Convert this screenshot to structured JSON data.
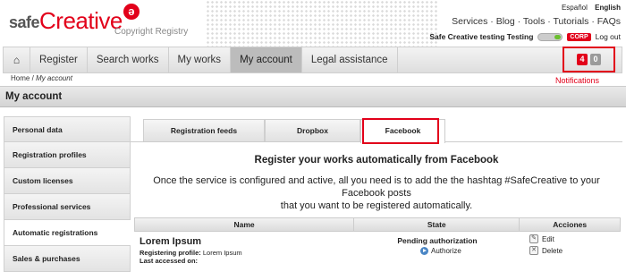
{
  "header": {
    "logo_safe": "safe",
    "logo_creative": "Creative",
    "logo_mark": "ə",
    "subtitle": "Copyright Registry",
    "languages": [
      "Español",
      "English"
    ],
    "toplinks": "Services · Blog · Tools · Tutorials · FAQs",
    "username": "Safe Creative testing Testing",
    "corp_badge": "CORP",
    "logout": "Log out"
  },
  "nav": {
    "home_icon": "⌂",
    "items": [
      "Register",
      "Search works",
      "My works",
      "My account",
      "Legal assistance"
    ],
    "active": "My account"
  },
  "notifications": {
    "count_new": "4",
    "count_other": "0",
    "label": "Notifications"
  },
  "breadcrumb": {
    "home": "Home",
    "separator": "/",
    "current": "My account"
  },
  "page_title": "My account",
  "sidebar": {
    "items": [
      "Personal data",
      "Registration profiles",
      "Custom licenses",
      "Professional services",
      "Automatic registrations",
      "Sales & purchases"
    ],
    "active": "Automatic registrations"
  },
  "tabs": {
    "items": [
      "Registration feeds",
      "Dropbox",
      "Facebook"
    ],
    "active": "Facebook"
  },
  "main": {
    "heading": "Register your works automatically from Facebook",
    "description_line1": "Once the service is configured and active, all you need is to add the the hashtag #SafeCreative to your Facebook posts",
    "description_line2": "that you want to be registered automatically."
  },
  "table": {
    "headers": [
      "Name",
      "State",
      "Acciones"
    ],
    "rows": [
      {
        "name": "Lorem Ipsum",
        "profile_label": "Registering profile:",
        "profile_value": "Lorem Ipsum",
        "accessed_label": "Last accessed on:",
        "state": "Pending authorization",
        "authorize": "Authorize",
        "edit": "Edit",
        "delete": "Delete"
      }
    ]
  },
  "colors": {
    "brand_red": "#e2001a",
    "active_nav": "#bcbcbc"
  }
}
